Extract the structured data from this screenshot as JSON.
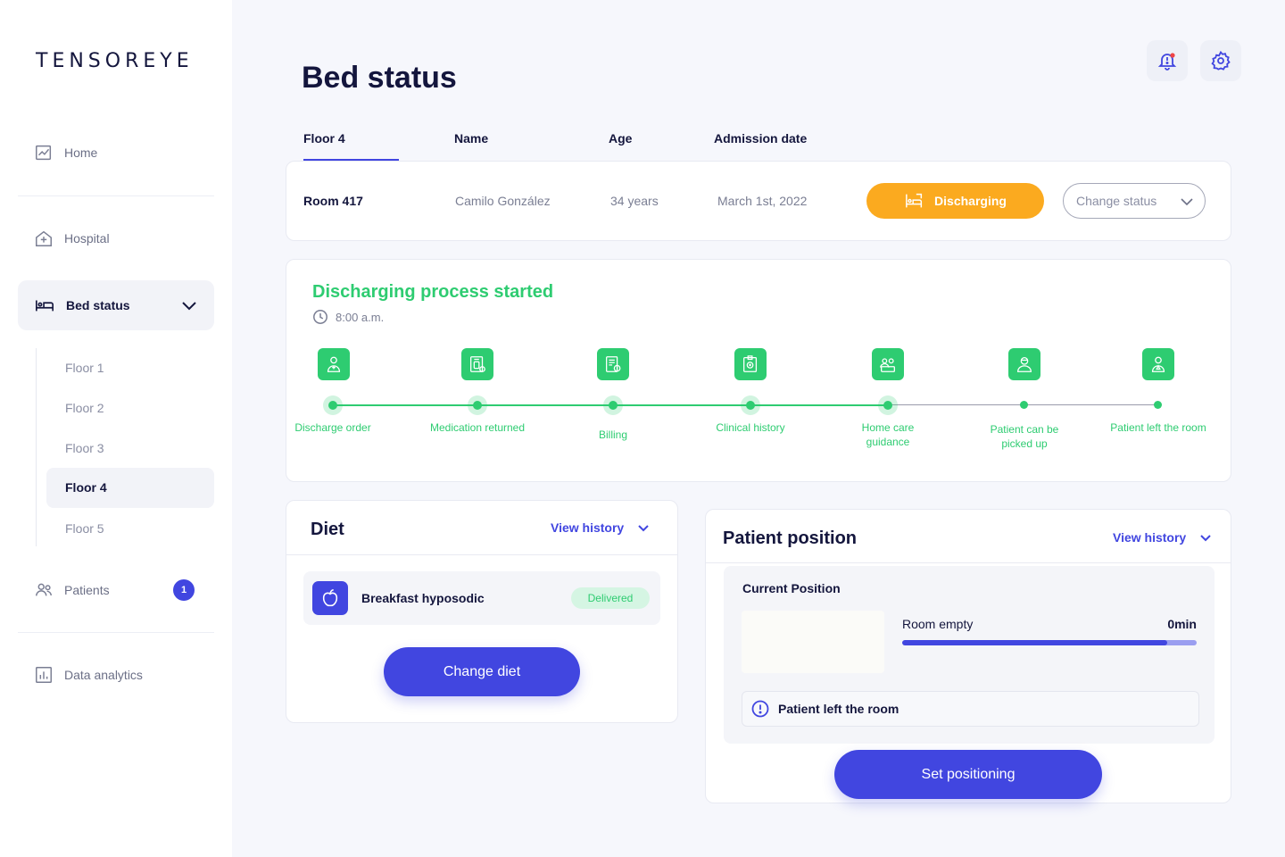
{
  "brand": "TENSOREYE",
  "nav": {
    "home": "Home",
    "hospital": "Hospital",
    "bed_status": "Bed status",
    "floors": [
      "Floor 1",
      "Floor 2",
      "Floor 3",
      "Floor 4",
      "Floor 5"
    ],
    "active_floor": "Floor 4",
    "patients": "Patients",
    "patients_badge": "1",
    "analytics": "Data analytics"
  },
  "header": {
    "title": "Bed status"
  },
  "table": {
    "columns": [
      "Floor 4",
      "Name",
      "Age",
      "Admission date"
    ],
    "row": {
      "room": "Room 417",
      "name": "Camilo González",
      "age": "34 years",
      "admission": "March 1st, 2022",
      "status": "Discharging",
      "change_status_placeholder": "Change status"
    }
  },
  "process": {
    "title": "Discharging process started",
    "time": "8:00 a.m.",
    "steps": [
      {
        "label": "Discharge order",
        "done": true
      },
      {
        "label": "Medication returned",
        "done": true
      },
      {
        "label": "Billing",
        "done": true
      },
      {
        "label": "Clinical history",
        "done": true
      },
      {
        "label": "Home care guidance",
        "done": true
      },
      {
        "label": "Patient can be picked up",
        "done": false
      },
      {
        "label": "Patient left the room",
        "done": false
      }
    ]
  },
  "diet": {
    "title": "Diet",
    "view_history": "View history",
    "item": "Breakfast hyposodic",
    "item_status": "Delivered",
    "button": "Change diet"
  },
  "position": {
    "title": "Patient position",
    "view_history": "View history",
    "current_label": "Current Position",
    "state": "Room empty",
    "duration": "0min",
    "progress": 0.9,
    "alert": "Patient left the room",
    "button": "Set positioning"
  },
  "colors": {
    "accent": "#4146e0",
    "success": "#2ecc71",
    "warning": "#fbaa1f",
    "text": "#14163d"
  }
}
